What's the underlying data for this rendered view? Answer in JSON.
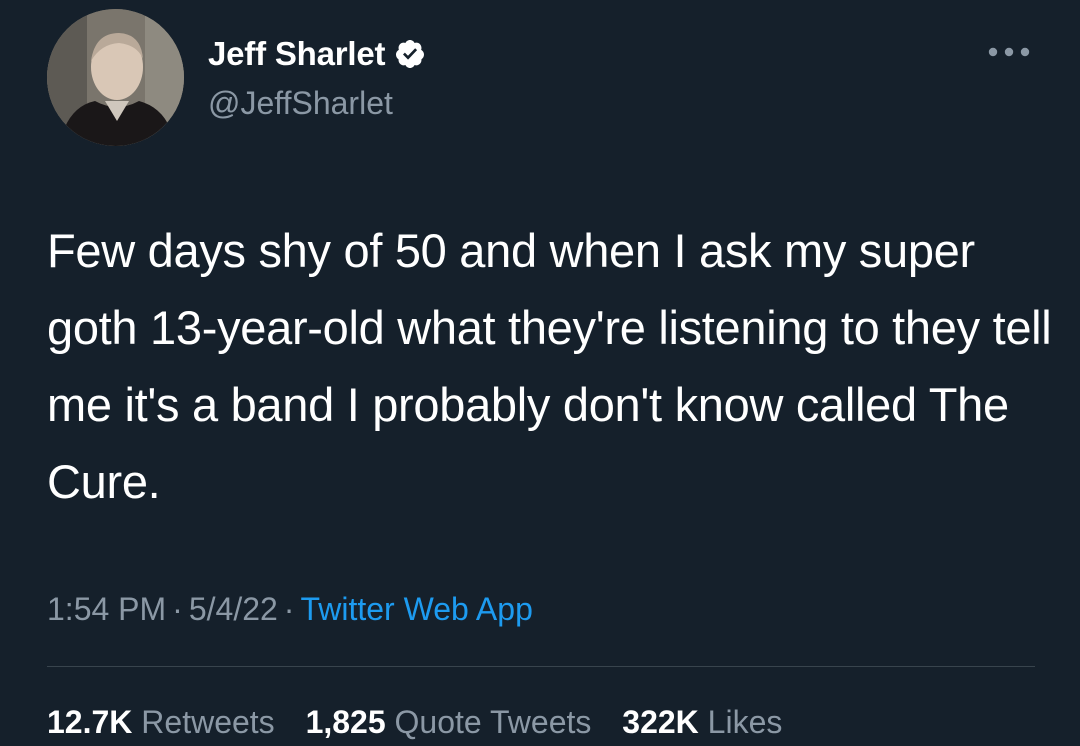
{
  "author": {
    "display_name": "Jeff Sharlet",
    "handle": "@JeffSharlet",
    "verified": true,
    "avatar_icon": "profile-photo"
  },
  "tweet": {
    "text": "Few days shy of 50 and when I ask my super goth 13-year-old what they're listening to they tell me it's a band I probably don't know called The Cure."
  },
  "meta": {
    "time": "1:54 PM",
    "separator": "·",
    "date": "5/4/22",
    "source": "Twitter Web App"
  },
  "stats": {
    "retweets_count": "12.7K",
    "retweets_label": "Retweets",
    "quote_count": "1,825",
    "quote_label": "Quote Tweets",
    "likes_count": "322K",
    "likes_label": "Likes"
  },
  "colors": {
    "background": "#15202b",
    "primary_text": "#ffffff",
    "secondary_text": "#8b98a5",
    "link": "#1d9bf0",
    "verified_badge": "#ffffff",
    "divider": "#38444d"
  },
  "icons": {
    "more": "more-horizontal-icon",
    "verified": "verified-badge-icon"
  }
}
